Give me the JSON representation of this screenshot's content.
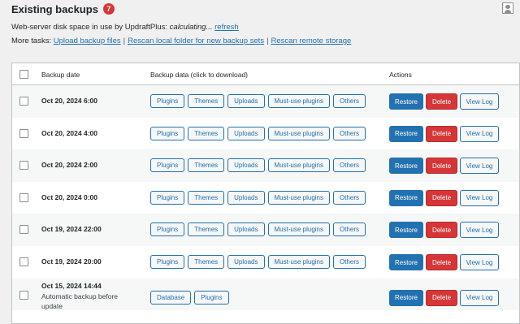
{
  "header": {
    "title": "Existing backups",
    "count": "7"
  },
  "disk_line": {
    "label": "Web-server disk space in use by UpdraftPlus:",
    "status": "calculating...",
    "refresh": "refresh"
  },
  "more_tasks": {
    "label": "More tasks:",
    "links": [
      "Upload backup files",
      "Rescan local folder for new backup sets",
      "Rescan remote storage"
    ]
  },
  "table": {
    "headers": {
      "date": "Backup date",
      "data": "Backup data (click to download)",
      "actions": "Actions"
    },
    "rows": [
      {
        "date": "Oct 20, 2024 6:00",
        "desc": "",
        "chips": [
          "Plugins",
          "Themes",
          "Uploads",
          "Must-use plugins",
          "Others"
        ]
      },
      {
        "date": "Oct 20, 2024 4:00",
        "desc": "",
        "chips": [
          "Plugins",
          "Themes",
          "Uploads",
          "Must-use plugins",
          "Others"
        ]
      },
      {
        "date": "Oct 20, 2024 2:00",
        "desc": "",
        "chips": [
          "Plugins",
          "Themes",
          "Uploads",
          "Must-use plugins",
          "Others"
        ]
      },
      {
        "date": "Oct 20, 2024 0:00",
        "desc": "",
        "chips": [
          "Plugins",
          "Themes",
          "Uploads",
          "Must-use plugins",
          "Others"
        ]
      },
      {
        "date": "Oct 19, 2024 22:00",
        "desc": "",
        "chips": [
          "Plugins",
          "Themes",
          "Uploads",
          "Must-use plugins",
          "Others"
        ]
      },
      {
        "date": "Oct 19, 2024 20:00",
        "desc": "",
        "chips": [
          "Plugins",
          "Themes",
          "Uploads",
          "Must-use plugins",
          "Others"
        ]
      },
      {
        "date": "Oct 15, 2024 14:44",
        "desc": "Automatic backup before update",
        "chips": [
          "Database",
          "Plugins"
        ]
      }
    ],
    "action_labels": {
      "restore": "Restore",
      "delete": "Delete",
      "view_log": "View Log"
    }
  },
  "colors": {
    "accent": "#2271b1",
    "danger": "#d63638",
    "badge": "#d63638",
    "background": "#f0f0f1"
  }
}
